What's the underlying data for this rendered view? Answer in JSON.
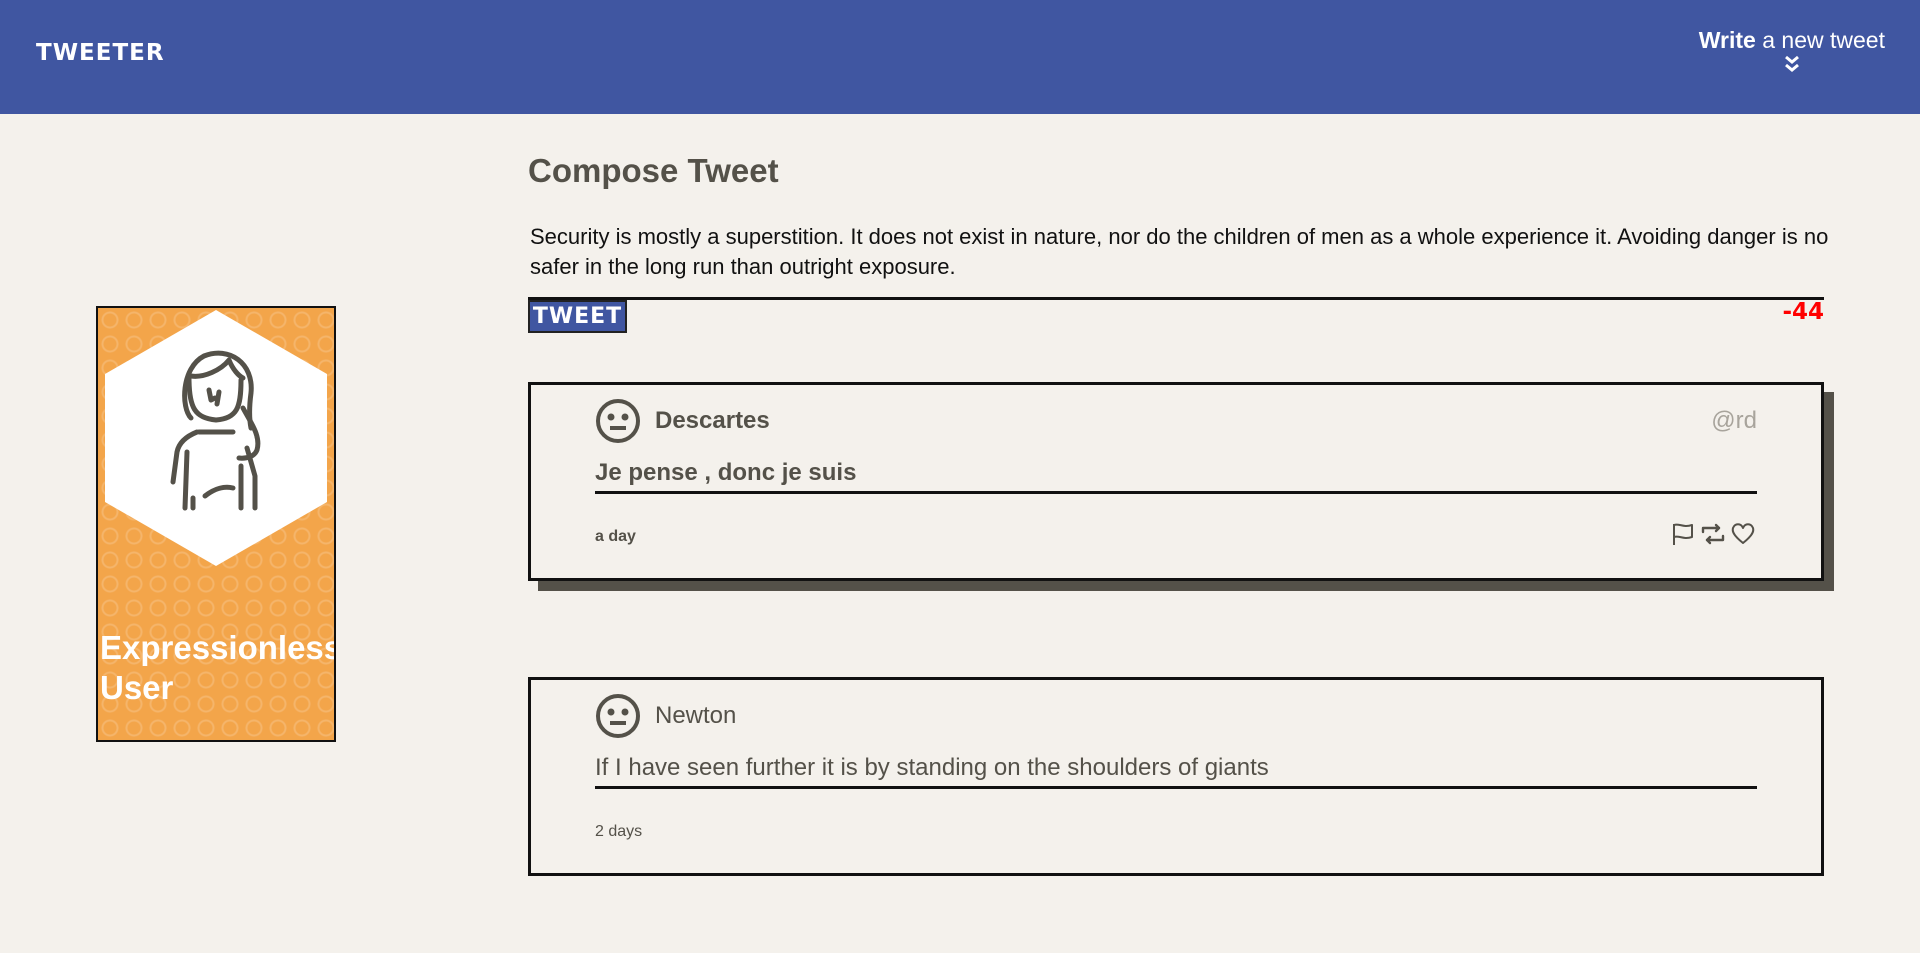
{
  "navbar": {
    "brand": "TWEETER",
    "write_bold": "Write",
    "write_rest": " a new tweet"
  },
  "profile": {
    "name": "Expressionless User",
    "card_color": "#f3a54a"
  },
  "compose": {
    "title": "Compose Tweet",
    "text": "Security is mostly a superstition. It does not exist in nature, nor do the children of men as a whole experience it. Avoiding danger is no safer in the long run than outright exposure.",
    "button_label": "TWEET",
    "counter": "-44"
  },
  "tweets": [
    {
      "author": "Descartes",
      "handle": "@rd",
      "content": "Je pense , donc je suis",
      "time": "a day",
      "actions": [
        "flag-icon",
        "retweet-icon",
        "heart-icon"
      ]
    },
    {
      "author": "Newton",
      "handle": "",
      "content": "If I have seen further it is by standing on the shoulders of giants",
      "time": "2 days",
      "actions": []
    }
  ],
  "colors": {
    "header": "#4056a1",
    "background": "#f4f1ec",
    "text": "#545149",
    "counter": "#ff0000"
  }
}
